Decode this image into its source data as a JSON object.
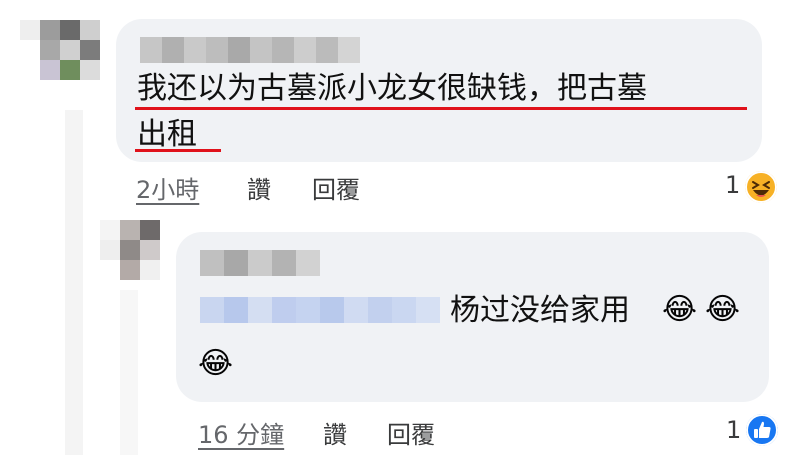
{
  "comments": [
    {
      "text_line1": "我还以为古墓派小龙女很缺钱，把古墓",
      "text_line2": "出租",
      "time": "2小時",
      "like_label": "讚",
      "reply_label": "回覆",
      "reaction_count": "1",
      "reaction_icon": "laughing-face-icon"
    },
    {
      "text": "杨过没给家用",
      "emojis": [
        "😂",
        "😂",
        "😂"
      ],
      "time": "16 分鐘",
      "like_label": "讚",
      "reply_label": "回覆",
      "reaction_count": "1",
      "reaction_icon": "thumbs-up-icon"
    }
  ],
  "colors": {
    "bubble": "#f0f2f5",
    "underline": "#e0121b",
    "like_blue": "#1877f2",
    "haha_yellow": "#f7b125"
  }
}
